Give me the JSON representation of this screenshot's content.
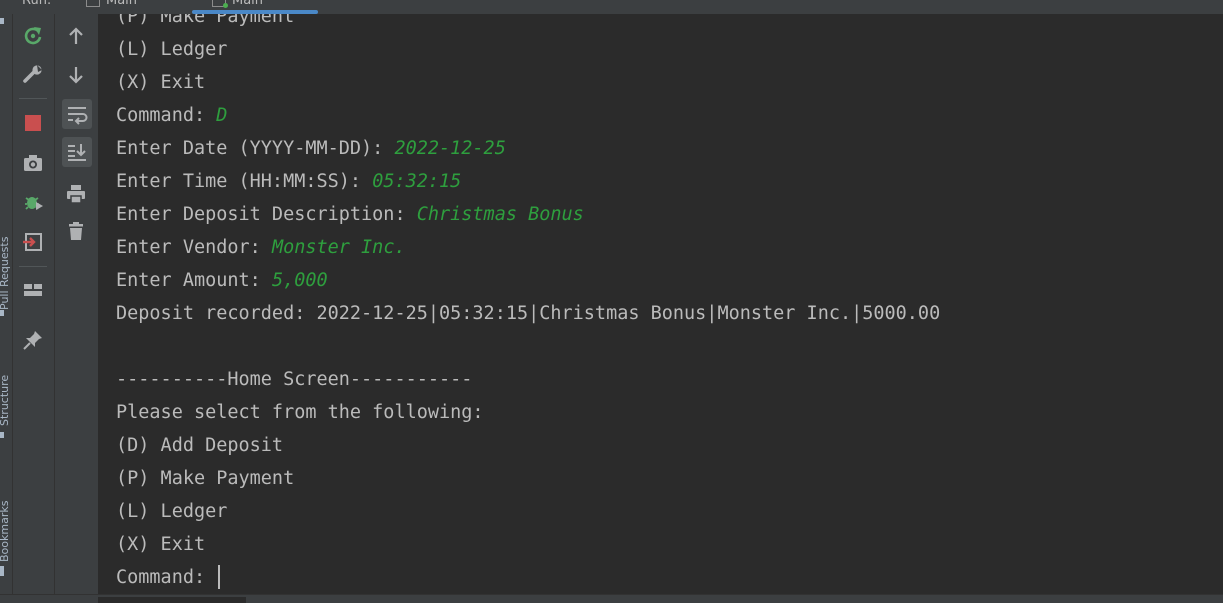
{
  "tabs": [
    {
      "label": "Run:"
    },
    {
      "label": "Main"
    },
    {
      "label": "Main"
    }
  ],
  "side_strip": {
    "labels": [
      "Pull Requests",
      "Structure",
      "Bookmarks"
    ]
  },
  "toolbar_left": {
    "icons": [
      "rerun-icon",
      "settings-wrench-icon",
      "stop-icon",
      "camera-icon",
      "debug-icon",
      "exit-icon",
      "layout-icon",
      "pin-icon"
    ]
  },
  "toolbar_right": {
    "icons": [
      "up-arrow-icon",
      "down-arrow-icon",
      "soft-wrap-icon",
      "scroll-to-end-icon",
      "print-icon",
      "trash-icon"
    ]
  },
  "colors": {
    "background": "#2b2b2b",
    "text": "#bbbbbb",
    "user_input": "#2e9f3e",
    "accent": "#4a88c7",
    "stop": "#c94f4f",
    "rerun": "#59a869"
  },
  "console": {
    "lines": [
      {
        "text": "(P) Make Payment",
        "input": ""
      },
      {
        "text": "(L) Ledger",
        "input": ""
      },
      {
        "text": "(X) Exit",
        "input": ""
      },
      {
        "text": "Command: ",
        "input": "D"
      },
      {
        "text": "Enter Date (YYYY-MM-DD): ",
        "input": "2022-12-25"
      },
      {
        "text": "Enter Time (HH:MM:SS): ",
        "input": "05:32:15"
      },
      {
        "text": "Enter Deposit Description: ",
        "input": "Christmas Bonus"
      },
      {
        "text": "Enter Vendor: ",
        "input": "Monster Inc."
      },
      {
        "text": "Enter Amount: ",
        "input": "5,000"
      },
      {
        "text": "Deposit recorded: 2022-12-25|05:32:15|Christmas Bonus|Monster Inc.|5000.00",
        "input": ""
      },
      {
        "text": "",
        "input": ""
      },
      {
        "text": "----------Home Screen-----------",
        "input": ""
      },
      {
        "text": "Please select from the following:",
        "input": ""
      },
      {
        "text": "(D) Add Deposit",
        "input": ""
      },
      {
        "text": "(P) Make Payment",
        "input": ""
      },
      {
        "text": "(L) Ledger",
        "input": ""
      },
      {
        "text": "(X) Exit",
        "input": ""
      },
      {
        "text": "Command: ",
        "input": ""
      }
    ]
  }
}
